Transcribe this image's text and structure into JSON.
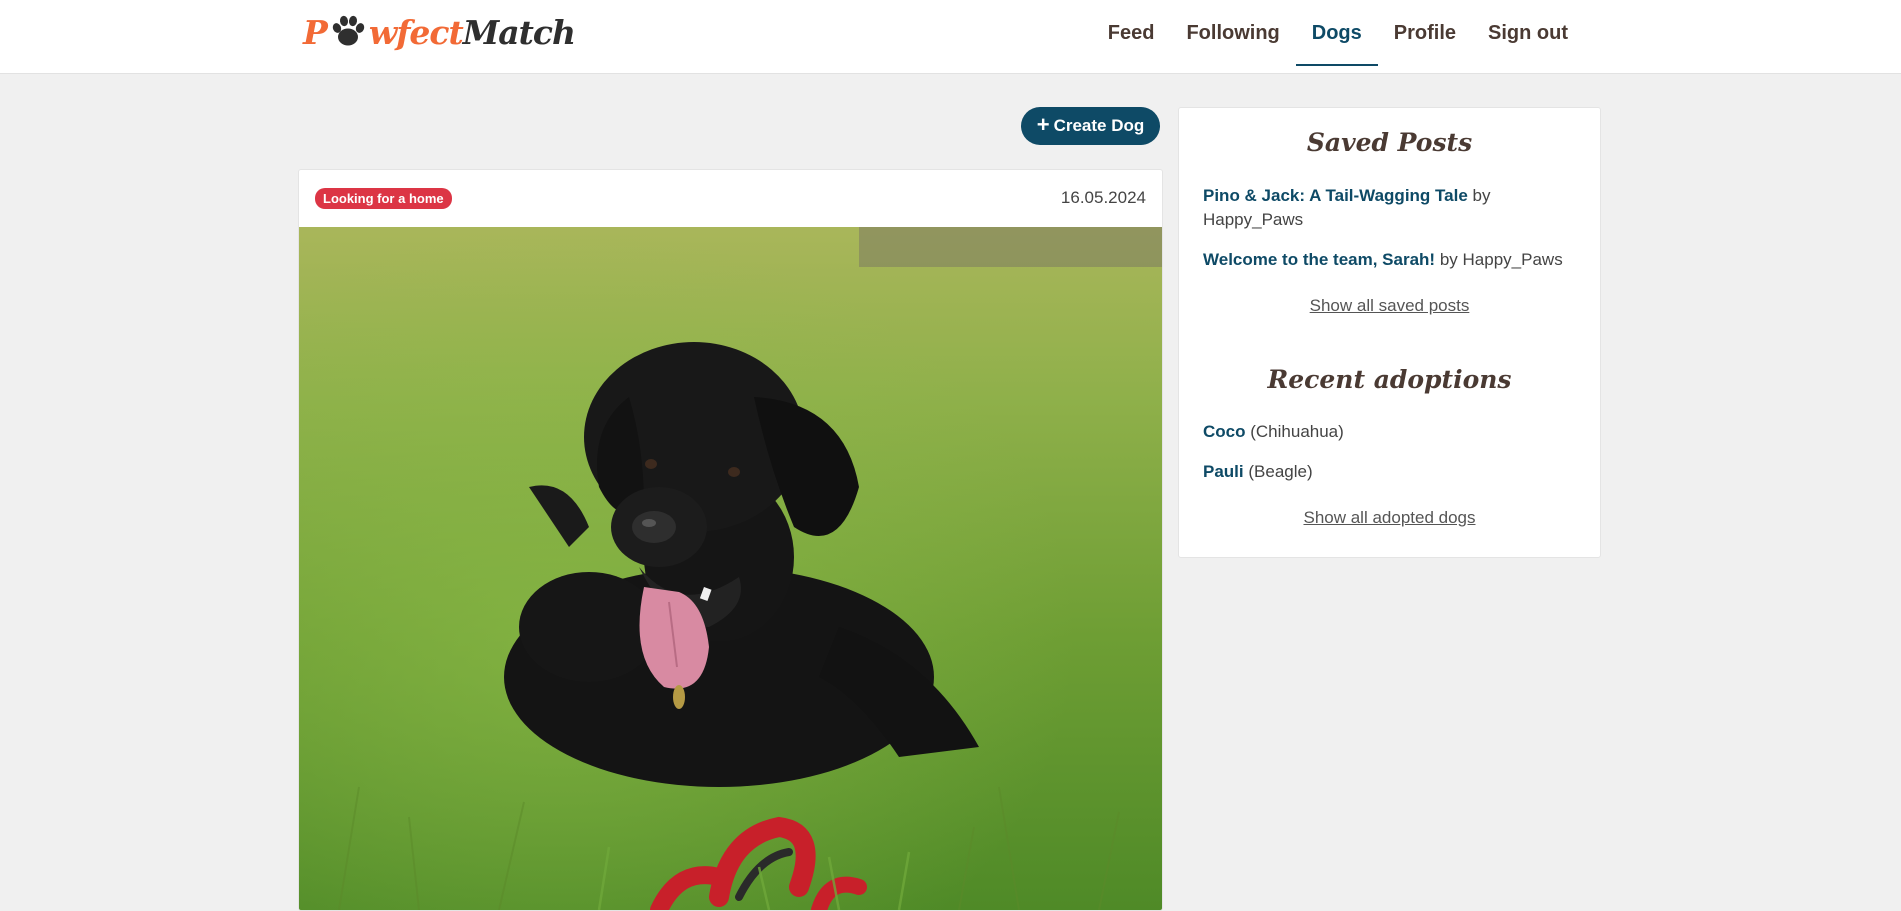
{
  "brand": {
    "logo_part1": "P",
    "logo_part2": "wfect",
    "logo_part3": "Match",
    "icon": "paw-icon",
    "accent_color": "#f26a36"
  },
  "nav": {
    "items": [
      {
        "label": "Feed"
      },
      {
        "label": "Following"
      },
      {
        "label": "Dogs",
        "active": true
      },
      {
        "label": "Profile"
      },
      {
        "label": "Sign out"
      }
    ],
    "active_color": "#0e4a66"
  },
  "toolbar": {
    "create_label": "Create Dog",
    "create_icon": "plus-icon"
  },
  "post": {
    "status_badge": "Looking for a home",
    "badge_color": "#dc3545",
    "date": "16.05.2024",
    "image": "black-labrador-on-grass"
  },
  "sidebar": {
    "saved_title": "Saved Posts",
    "saved_posts": [
      {
        "title": "Pino & Jack: A Tail-Wagging Tale",
        "by": "by",
        "author": "Happy_Paws"
      },
      {
        "title": "Welcome to the team, Sarah!",
        "by": "by",
        "author": "Happy_Paws"
      }
    ],
    "show_saved": "Show all saved posts",
    "recent_title": "Recent adoptions",
    "adoptions": [
      {
        "name": "Coco",
        "breed": "(Chihuahua)"
      },
      {
        "name": "Pauli",
        "breed": "(Beagle)"
      }
    ],
    "show_adopted": "Show all adopted dogs"
  }
}
